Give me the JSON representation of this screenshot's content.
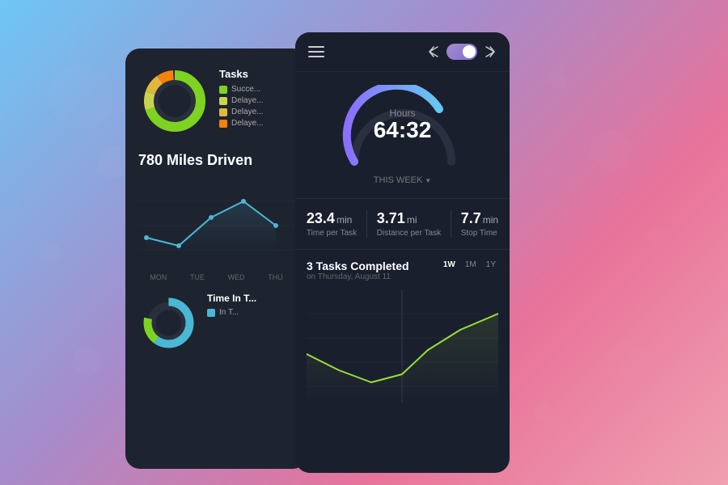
{
  "background": {
    "gradient_start": "#6ec6f5",
    "gradient_end": "#f0a0b0"
  },
  "back_card": {
    "tasks_title": "Tasks",
    "legend": [
      {
        "label": "Succe...",
        "color": "#7ed321"
      },
      {
        "label": "Delaye...",
        "color": "#c8d44e"
      },
      {
        "label": "Delaye...",
        "color": "#e0b840"
      },
      {
        "label": "Delaye...",
        "color": "#f5820a"
      }
    ],
    "miles_driven": "780 Miles Driven",
    "chart_labels": [
      "MON",
      "TUE",
      "WED",
      "THU"
    ],
    "time_in_title": "Time In T..."
  },
  "front_card": {
    "header": {
      "hamburger_label": "menu",
      "toggle_state": "on"
    },
    "gauge": {
      "label": "Hours",
      "value": "64:32",
      "this_week": "THIS WEEK"
    },
    "stats": [
      {
        "value": "23.4",
        "unit": "min",
        "label": "Time per Task"
      },
      {
        "value": "3.71",
        "unit": "mi",
        "label": "Distance per Task"
      },
      {
        "value": "7.7",
        "unit": "min",
        "label": "Stop Time"
      }
    ],
    "tasks_section": {
      "title": "3 Tasks Completed",
      "date": "on Thursday, August 11",
      "periods": [
        "1W",
        "1M",
        "1Y"
      ],
      "active_period": "1W"
    }
  }
}
